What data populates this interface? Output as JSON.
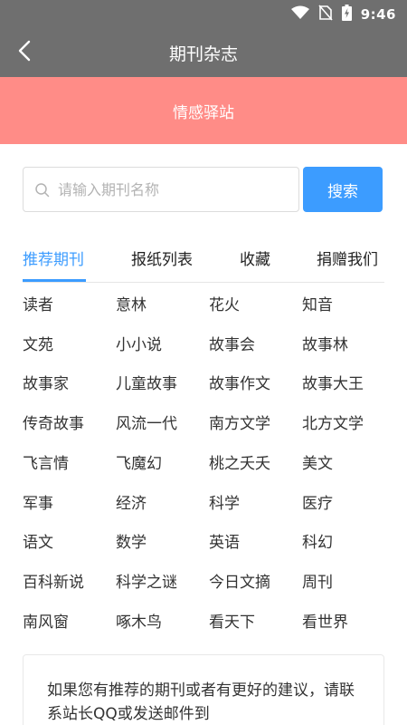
{
  "status_bar": {
    "time": "9:46"
  },
  "app_bar": {
    "title": "期刊杂志"
  },
  "banner": {
    "text": "情感驿站"
  },
  "search": {
    "placeholder": "请输入期刊名称",
    "button_label": "搜索"
  },
  "tabs": [
    {
      "label": "推荐期刊",
      "active": true
    },
    {
      "label": "报纸列表",
      "active": false
    },
    {
      "label": "收藏",
      "active": false
    },
    {
      "label": "捐赠我们",
      "active": false
    }
  ],
  "magazines": [
    [
      "读者",
      "意林",
      "花火",
      "知音"
    ],
    [
      "文苑",
      "小小说",
      "故事会",
      "故事林"
    ],
    [
      "故事家",
      "儿童故事",
      "故事作文",
      "故事大王"
    ],
    [
      "传奇故事",
      "风流一代",
      "南方文学",
      "北方文学"
    ],
    [
      "飞言情",
      "飞魔幻",
      "桃之夭夭",
      "美文"
    ],
    [
      "军事",
      "经济",
      "科学",
      "医疗"
    ],
    [
      "语文",
      "数学",
      "英语",
      "科幻"
    ],
    [
      "百科新说",
      "科学之谜",
      "今日文摘",
      "周刊"
    ],
    [
      "南风窗",
      "啄木鸟",
      "看天下",
      "看世界"
    ]
  ],
  "notice": {
    "text": "如果您有推荐的期刊或者有更好的建议，请联系站长QQ或发送邮件到"
  },
  "colors": {
    "bar": "#6f6f6f",
    "banner": "#ff8c87",
    "accent": "#3c9cff"
  }
}
